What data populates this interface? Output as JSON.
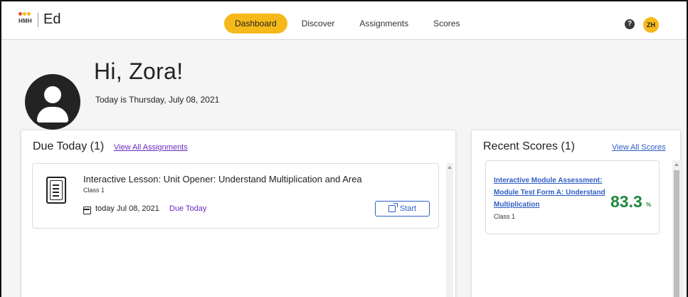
{
  "header": {
    "logo_brand": "HMH",
    "logo_app": "Ed",
    "logo_dot_colors": [
      "#e94b3c",
      "#f6b91a",
      "#f6b91a"
    ],
    "nav": [
      {
        "label": "Dashboard",
        "active": true
      },
      {
        "label": "Discover",
        "active": false
      },
      {
        "label": "Assignments",
        "active": false
      },
      {
        "label": "Scores",
        "active": false
      }
    ],
    "help_icon": "?",
    "user_initials": "ZH"
  },
  "greeting": {
    "title": "Hi, Zora!",
    "date_text": "Today is Thursday, July 08, 2021"
  },
  "due_today": {
    "title": "Due Today (1)",
    "view_all_label": "View All Assignments",
    "assignments": [
      {
        "title": "Interactive Lesson: Unit Opener: Understand Multiplication and Area",
        "class": "Class 1",
        "due_date": "today Jul 08, 2021",
        "due_flag": "Due Today",
        "action_label": "Start"
      }
    ]
  },
  "recent_scores": {
    "title": "Recent Scores (1)",
    "view_all_label": "View All Scores",
    "items": [
      {
        "title": "Interactive Module Assessment: Module Test Form A: Understand Multiplication",
        "class": "Class 1",
        "score": "83.3",
        "unit": "%"
      }
    ]
  },
  "colors": {
    "accent": "#f6b91a",
    "link_purple": "#6a2bbf",
    "link_blue": "#2f5fc4",
    "score_green": "#1e8a3c"
  }
}
